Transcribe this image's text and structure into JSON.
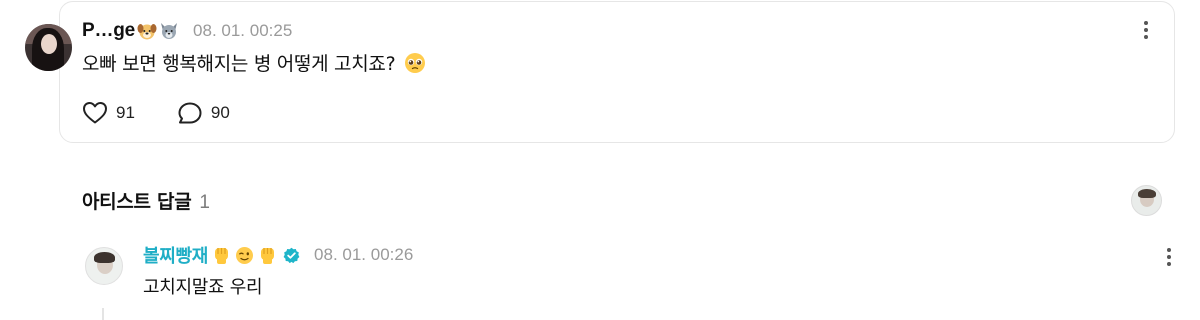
{
  "post": {
    "author": "P…ge",
    "author_emojis": [
      "dog-face-emoji",
      "wolf-face-emoji"
    ],
    "timestamp": "08. 01. 00:25",
    "text": "오빠 보면 행복해지는 병 어떻게 고치죠?",
    "text_emoji": "pleading-face-emoji",
    "likes": "91",
    "comments": "90"
  },
  "artist_replies": {
    "label": "아티스트 답글",
    "count": "1"
  },
  "reply": {
    "author": "볼찌빵재",
    "author_emojis": [
      "raised-fist-emoji",
      "winking-face-emoji",
      "raised-fist-emoji"
    ],
    "verified": true,
    "timestamp": "08. 01. 00:26",
    "text": "고치지말죠 우리"
  },
  "colors": {
    "reply_author": "#1faec6",
    "verified_badge": "#1fb5c9",
    "timestamp": "#9a9a9a",
    "card_border": "#e6e6e6"
  }
}
